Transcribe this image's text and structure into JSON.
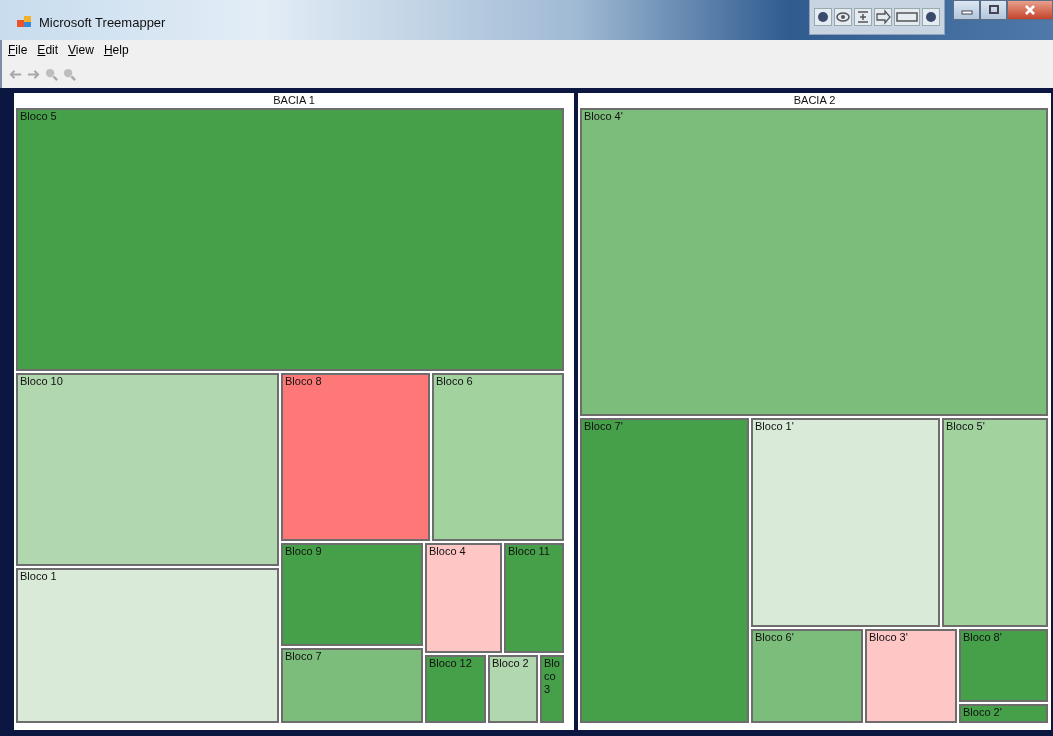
{
  "window": {
    "title": "Microsoft Treemapper"
  },
  "menu": [
    "File",
    "Edit",
    "View",
    "Help"
  ],
  "toolbar": [
    {
      "kind": "back",
      "disabled": true
    },
    {
      "kind": "forward",
      "disabled": true
    },
    {
      "kind": "zoom-in",
      "disabled": true
    },
    {
      "kind": "zoom-out",
      "disabled": true
    }
  ],
  "panels": [
    {
      "title": "BACIA 1",
      "blocks": [
        {
          "label": "Bloco 5",
          "color": "#45a049"
        },
        {
          "label": "Bloco 10",
          "color": "#b1d7ae"
        },
        {
          "label": "Bloco 1",
          "color": "#d9ead9"
        },
        {
          "label": "Bloco 8",
          "color": "#ff7878"
        },
        {
          "label": "Bloco 6",
          "color": "#a2d39f"
        },
        {
          "label": "Bloco 9",
          "color": "#45a049"
        },
        {
          "label": "Bloco 7",
          "color": "#7dbd7b"
        },
        {
          "label": "Bloco 4",
          "color": "#ffc6c6"
        },
        {
          "label": "Bloco 11",
          "color": "#45a049"
        },
        {
          "label": "Bloco 12",
          "color": "#45a049"
        },
        {
          "label": "Bloco 2",
          "color": "#b1d7ae"
        },
        {
          "label": "Bloco 3",
          "color": "#45a049"
        }
      ]
    },
    {
      "title": "BACIA 2",
      "blocks": [
        {
          "label": "Bloco 4'",
          "color": "#7dbd7b"
        },
        {
          "label": "Bloco 7'",
          "color": "#45a049"
        },
        {
          "label": "Bloco 1'",
          "color": "#d9ead9"
        },
        {
          "label": "Bloco 5'",
          "color": "#a2d39f"
        },
        {
          "label": "Bloco 6'",
          "color": "#7dbd7b"
        },
        {
          "label": "Bloco 3'",
          "color": "#ffc6c6"
        },
        {
          "label": "Bloco 8'",
          "color": "#45a049"
        },
        {
          "label": "Bloco 2'",
          "color": "#45a049"
        }
      ]
    }
  ]
}
